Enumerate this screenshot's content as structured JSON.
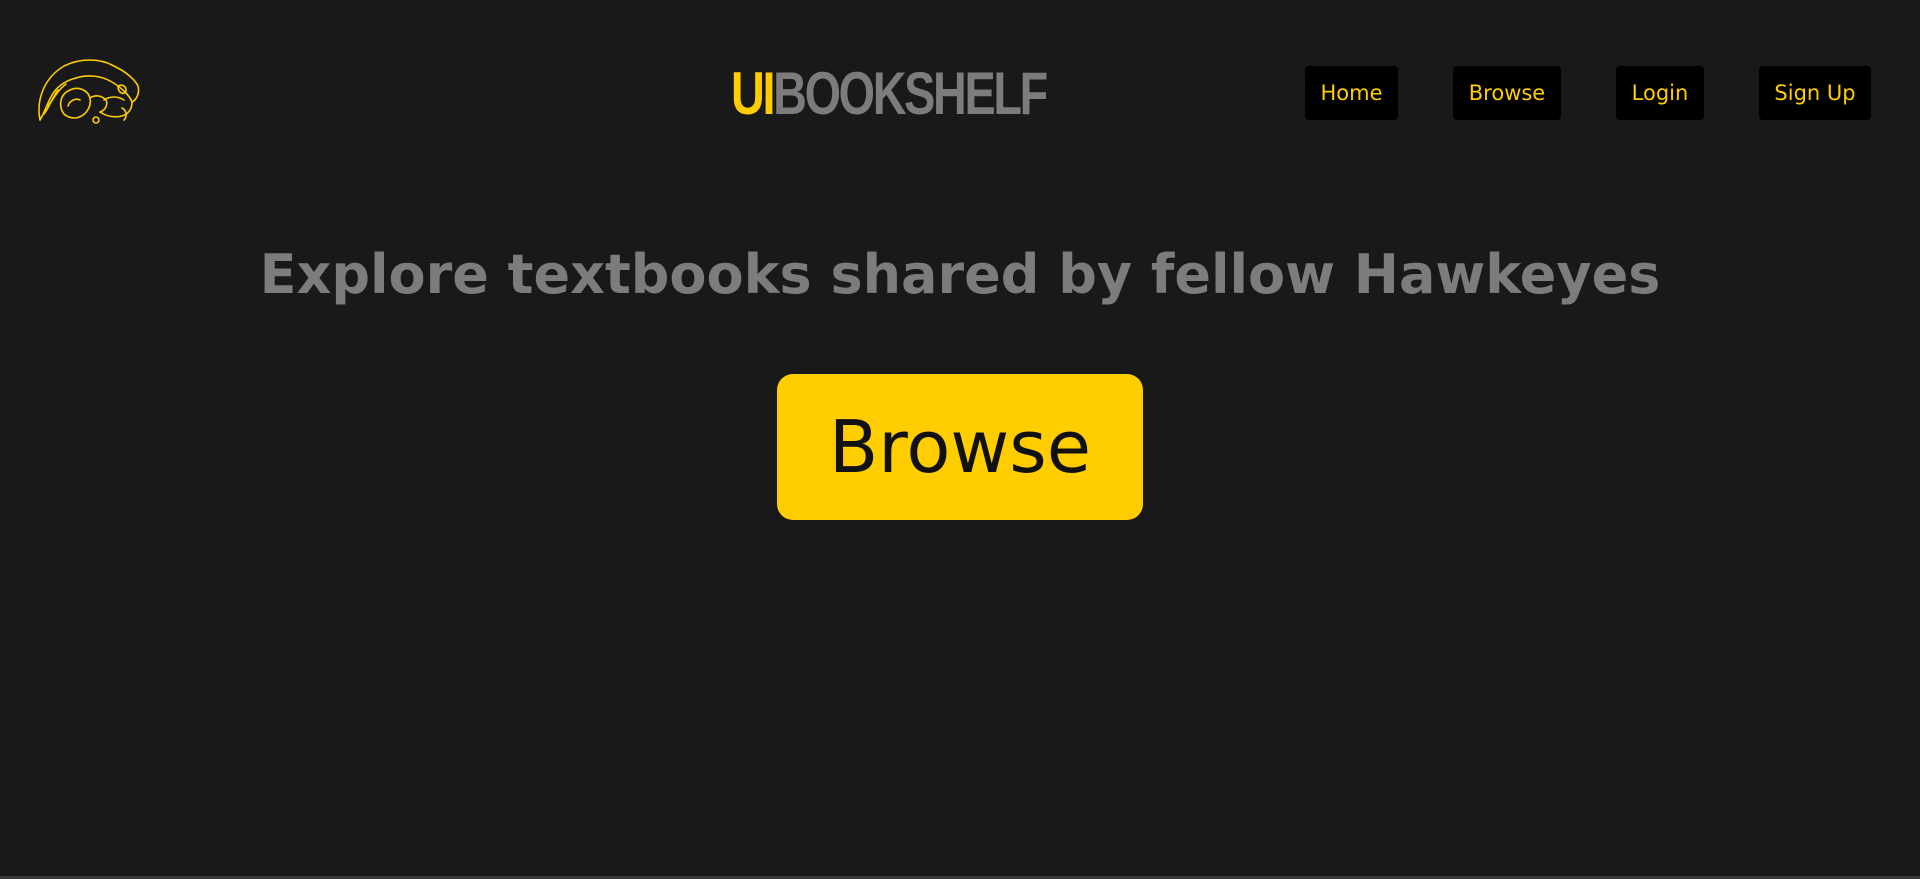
{
  "header": {
    "logo_icon": "hawkeye-tigerhawk-icon",
    "brand": {
      "part1": "UI",
      "part2": "BOOKSHELF"
    },
    "nav": [
      {
        "label": "Home"
      },
      {
        "label": "Browse"
      },
      {
        "label": "Login"
      },
      {
        "label": "Sign Up"
      }
    ]
  },
  "main": {
    "headline": "Explore textbooks shared by fellow Hawkeyes",
    "cta_label": "Browse"
  },
  "colors": {
    "background": "#191919",
    "accent": "#FFCD00",
    "muted_text": "#7C7C7C",
    "nav_button_bg": "#000000"
  }
}
